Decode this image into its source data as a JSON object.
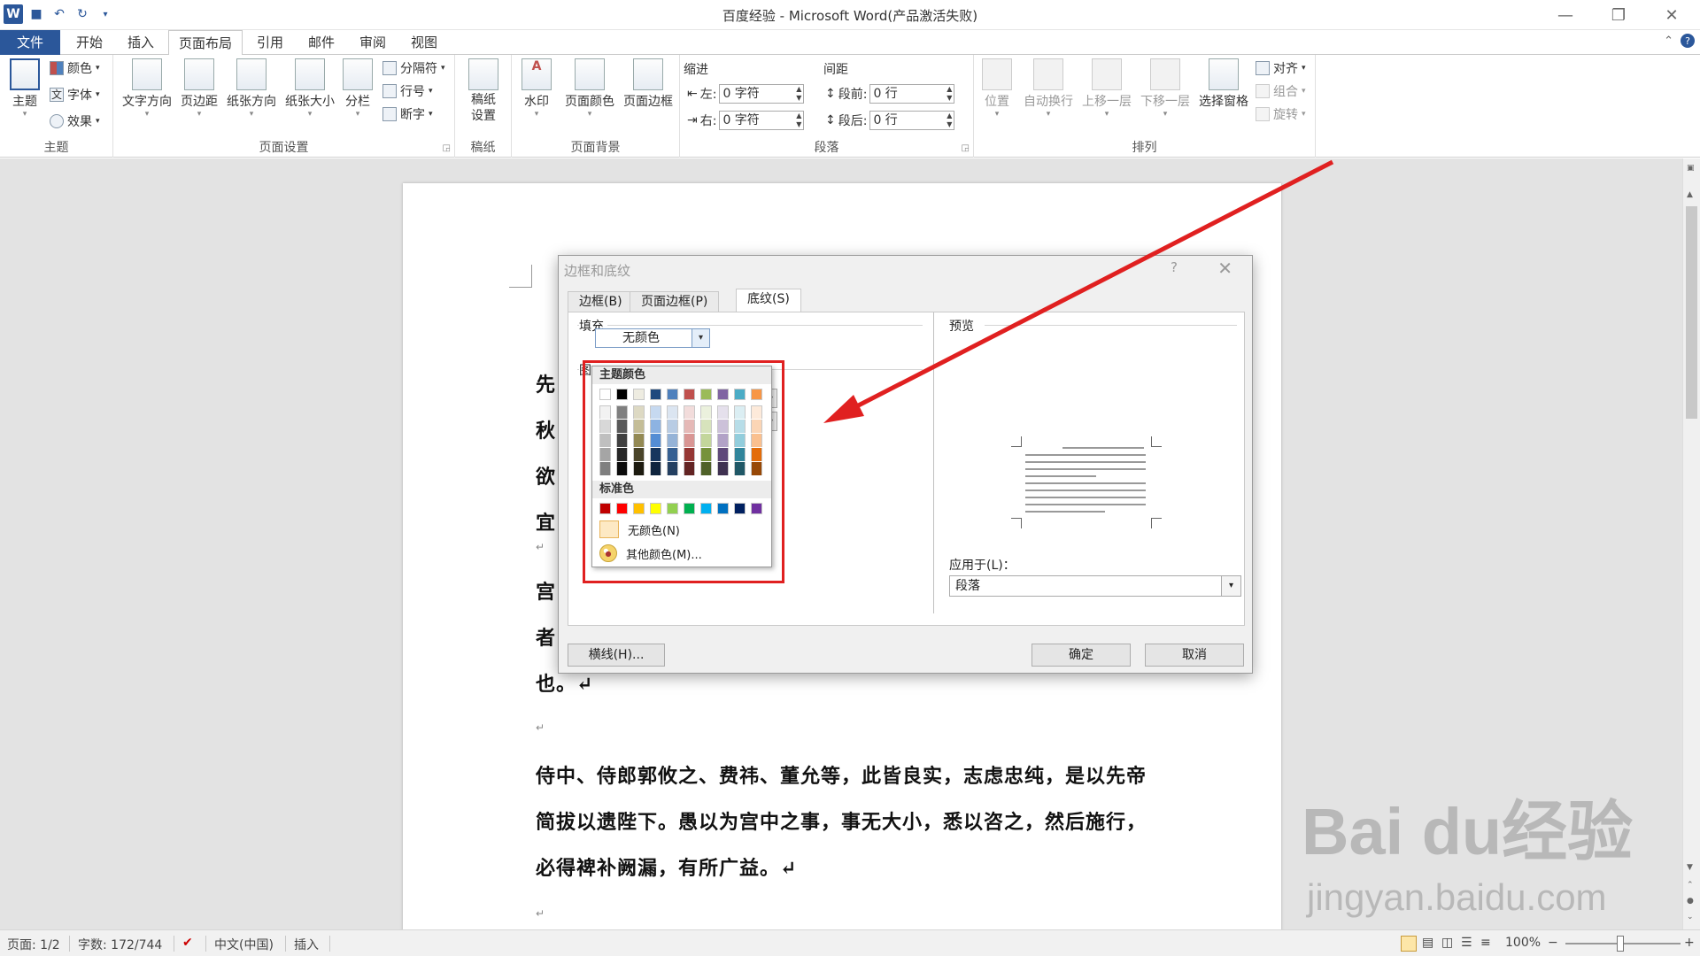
{
  "window": {
    "title": "百度经验 - Microsoft Word(产品激活失败)",
    "controls": [
      "—",
      "❐",
      "✕"
    ]
  },
  "ribbon_tabs": [
    "文件",
    "开始",
    "插入",
    "页面布局",
    "引用",
    "邮件",
    "审阅",
    "视图"
  ],
  "ribbon": {
    "theme": {
      "label": "主题",
      "big": "主题",
      "colors": "颜色",
      "fonts": "字体",
      "effects": "效果"
    },
    "page_setup": {
      "label": "页面设置",
      "text_dir": "文字方向",
      "margins": "页边距",
      "orientation": "纸张方向",
      "size": "纸张大小",
      "columns": "分栏",
      "breaks": "分隔符",
      "line_numbers": "行号",
      "hyphenation": "断字"
    },
    "manuscript": {
      "label": "稿纸",
      "btn": "稿纸设置"
    },
    "background": {
      "label": "页面背景",
      "watermark": "水印",
      "page_color": "页面颜色",
      "page_borders": "页面边框"
    },
    "paragraph": {
      "label": "段落",
      "indent_title": "缩进",
      "indent_left": "左:",
      "indent_left_val": "0 字符",
      "indent_right": "右:",
      "indent_right_val": "0 字符",
      "spacing_title": "间距",
      "before": "段前:",
      "before_val": "0 行",
      "after": "段后:",
      "after_val": "0 行"
    },
    "arrange": {
      "label": "排列",
      "position": "位置",
      "wrap": "自动换行",
      "forward": "上移一层",
      "backward": "下移一层",
      "selection": "选择窗格",
      "align": "对齐",
      "group": "组合",
      "rotate": "旋转"
    }
  },
  "document": {
    "lines": [
      "先",
      "秋",
      "欲",
      "宜",
      "宫",
      "者",
      "也。↵",
      "侍中、侍郎郭攸之、费祎、董允等，此皆良实，志虑忠纯，是以先帝",
      "简拔以遗陛下。愚以为宫中之事，事无大小，悉以咨之，然后施行，",
      "必得裨补阙漏，有所广益。↵"
    ],
    "para_mark": "↵"
  },
  "dialog": {
    "title": "边框和底纹",
    "help": "?",
    "close": "✕",
    "tabs": [
      "边框(B)",
      "页面边框(P)",
      "底纹(S)"
    ],
    "fill_label": "填充",
    "fill_value": "无颜色",
    "pattern_label_fragment": "图",
    "preview_label": "预览",
    "apply_label": "应用于(L)：",
    "apply_value": "段落",
    "btn_horizontal": "横线(H)...",
    "btn_ok": "确定",
    "btn_cancel": "取消"
  },
  "color_popup": {
    "theme_header": "主题颜色",
    "standard_header": "标准色",
    "no_color": "无颜色(N)",
    "more_colors": "其他颜色(M)...",
    "theme_top": [
      "#FFFFFF",
      "#000000",
      "#EEECE1",
      "#1F497D",
      "#4F81BD",
      "#C0504D",
      "#9BBB59",
      "#8064A2",
      "#4BACC6",
      "#F79646"
    ],
    "theme_shades": [
      [
        "#F2F2F2",
        "#7F7F7F",
        "#DDD9C3",
        "#C6D9F0",
        "#DBE5F1",
        "#F2DCDB",
        "#EBF1DD",
        "#E5E0EC",
        "#DBEEF3",
        "#FDEADA"
      ],
      [
        "#D8D8D8",
        "#595959",
        "#C4BD97",
        "#8DB3E2",
        "#B8CCE4",
        "#E5B9B7",
        "#D7E3BC",
        "#CCC1D9",
        "#B7DDE8",
        "#FBD5B5"
      ],
      [
        "#BFBFBF",
        "#3F3F3F",
        "#938953",
        "#548DD4",
        "#95B3D7",
        "#D99694",
        "#C3D69B",
        "#B2A2C7",
        "#92CDDC",
        "#FAC08F"
      ],
      [
        "#A5A5A5",
        "#262626",
        "#494429",
        "#17365D",
        "#366092",
        "#953734",
        "#76923C",
        "#5F497A",
        "#31859B",
        "#E36C09"
      ],
      [
        "#7F7F7F",
        "#0C0C0C",
        "#1D1B10",
        "#0F243E",
        "#244061",
        "#632423",
        "#4F6128",
        "#3F3151",
        "#205867",
        "#974806"
      ]
    ],
    "standard": [
      "#C00000",
      "#FF0000",
      "#FFC000",
      "#FFFF00",
      "#92D050",
      "#00B050",
      "#00B0F0",
      "#0070C0",
      "#002060",
      "#7030A0"
    ]
  },
  "statusbar": {
    "page": "页面: 1/2",
    "words": "字数: 172/744",
    "lang": "中文(中国)",
    "mode": "插入",
    "zoom": "100%",
    "zoom_minus": "−",
    "zoom_plus": "+"
  },
  "watermark": {
    "logo": "Bai du经验",
    "url": "jingyan.baidu.com"
  },
  "colors": {
    "accent": "#2b579a",
    "annotation": "#e02020"
  }
}
